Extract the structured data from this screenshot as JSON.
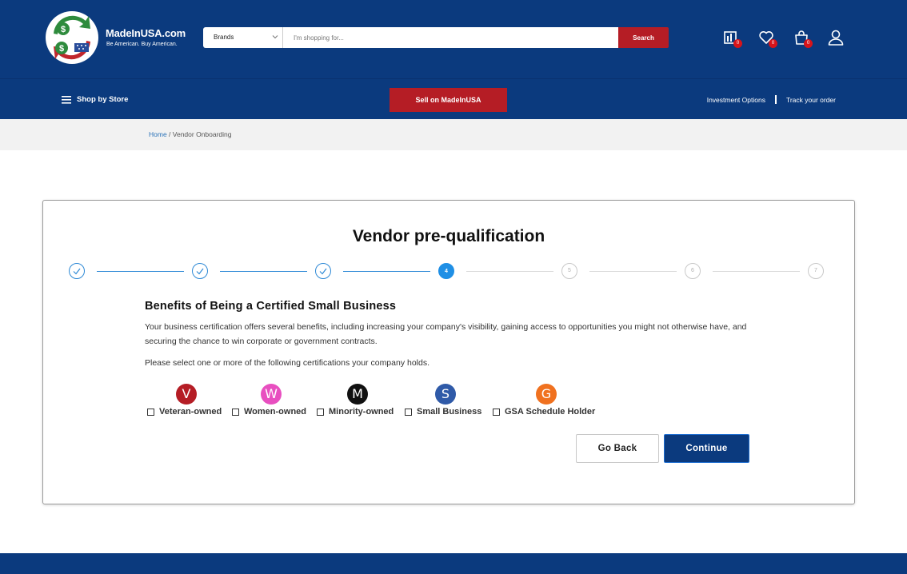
{
  "header": {
    "logo_name": "MadeInUSA.com",
    "logo_tagline": "Be American. Buy American.",
    "brand_select": "Brands",
    "search_placeholder": "I'm shopping for...",
    "search_button": "Search",
    "icons": [
      {
        "name": "compare-icon",
        "count": "0"
      },
      {
        "name": "wishlist-heart-icon",
        "count": "0"
      },
      {
        "name": "cart-bag-icon",
        "count": "0"
      },
      {
        "name": "user-account-icon",
        "count": ""
      }
    ]
  },
  "nav": {
    "shop_by_store": "Shop by Store",
    "sell_button": "Sell on MadeInUSA",
    "investment": "Investment Options",
    "track": "Track your order"
  },
  "breadcrumb": {
    "home": "Home",
    "separator": " / ",
    "current": "Vendor Onboarding"
  },
  "card": {
    "title": "Vendor pre-qualification",
    "steps": [
      {
        "label": "",
        "state": "done"
      },
      {
        "label": "",
        "state": "done"
      },
      {
        "label": "",
        "state": "done"
      },
      {
        "label": "4",
        "state": "active"
      },
      {
        "label": "5",
        "state": "todo"
      },
      {
        "label": "6",
        "state": "todo"
      },
      {
        "label": "7",
        "state": "todo"
      }
    ],
    "section_title": "Benefits of Being a Certified Small Business",
    "description": "Your business certification offers several benefits, including increasing your company's visibility, gaining access to opportunities you might not otherwise have, and securing the chance to win corporate or government contracts.",
    "prompt": "Please select one or more of the following certifications your company holds.",
    "certifications": [
      {
        "letter": "V",
        "label": "Veteran-owned",
        "color": "#b51d25",
        "checked": false
      },
      {
        "letter": "W",
        "label": "Women-owned",
        "color": "#e84fc0",
        "checked": false
      },
      {
        "letter": "M",
        "label": "Minority-owned",
        "color": "#111111",
        "checked": false
      },
      {
        "letter": "S",
        "label": "Small Business",
        "color": "#2f5aa8",
        "checked": false
      },
      {
        "letter": "G",
        "label": "GSA Schedule Holder",
        "color": "#f0711f",
        "checked": false
      }
    ],
    "back_button": "Go Back",
    "continue_button": "Continue"
  },
  "colors": {
    "brand_navy": "#0b3a7e",
    "brand_red": "#b51d25",
    "step_blue": "#1f8fe5"
  }
}
